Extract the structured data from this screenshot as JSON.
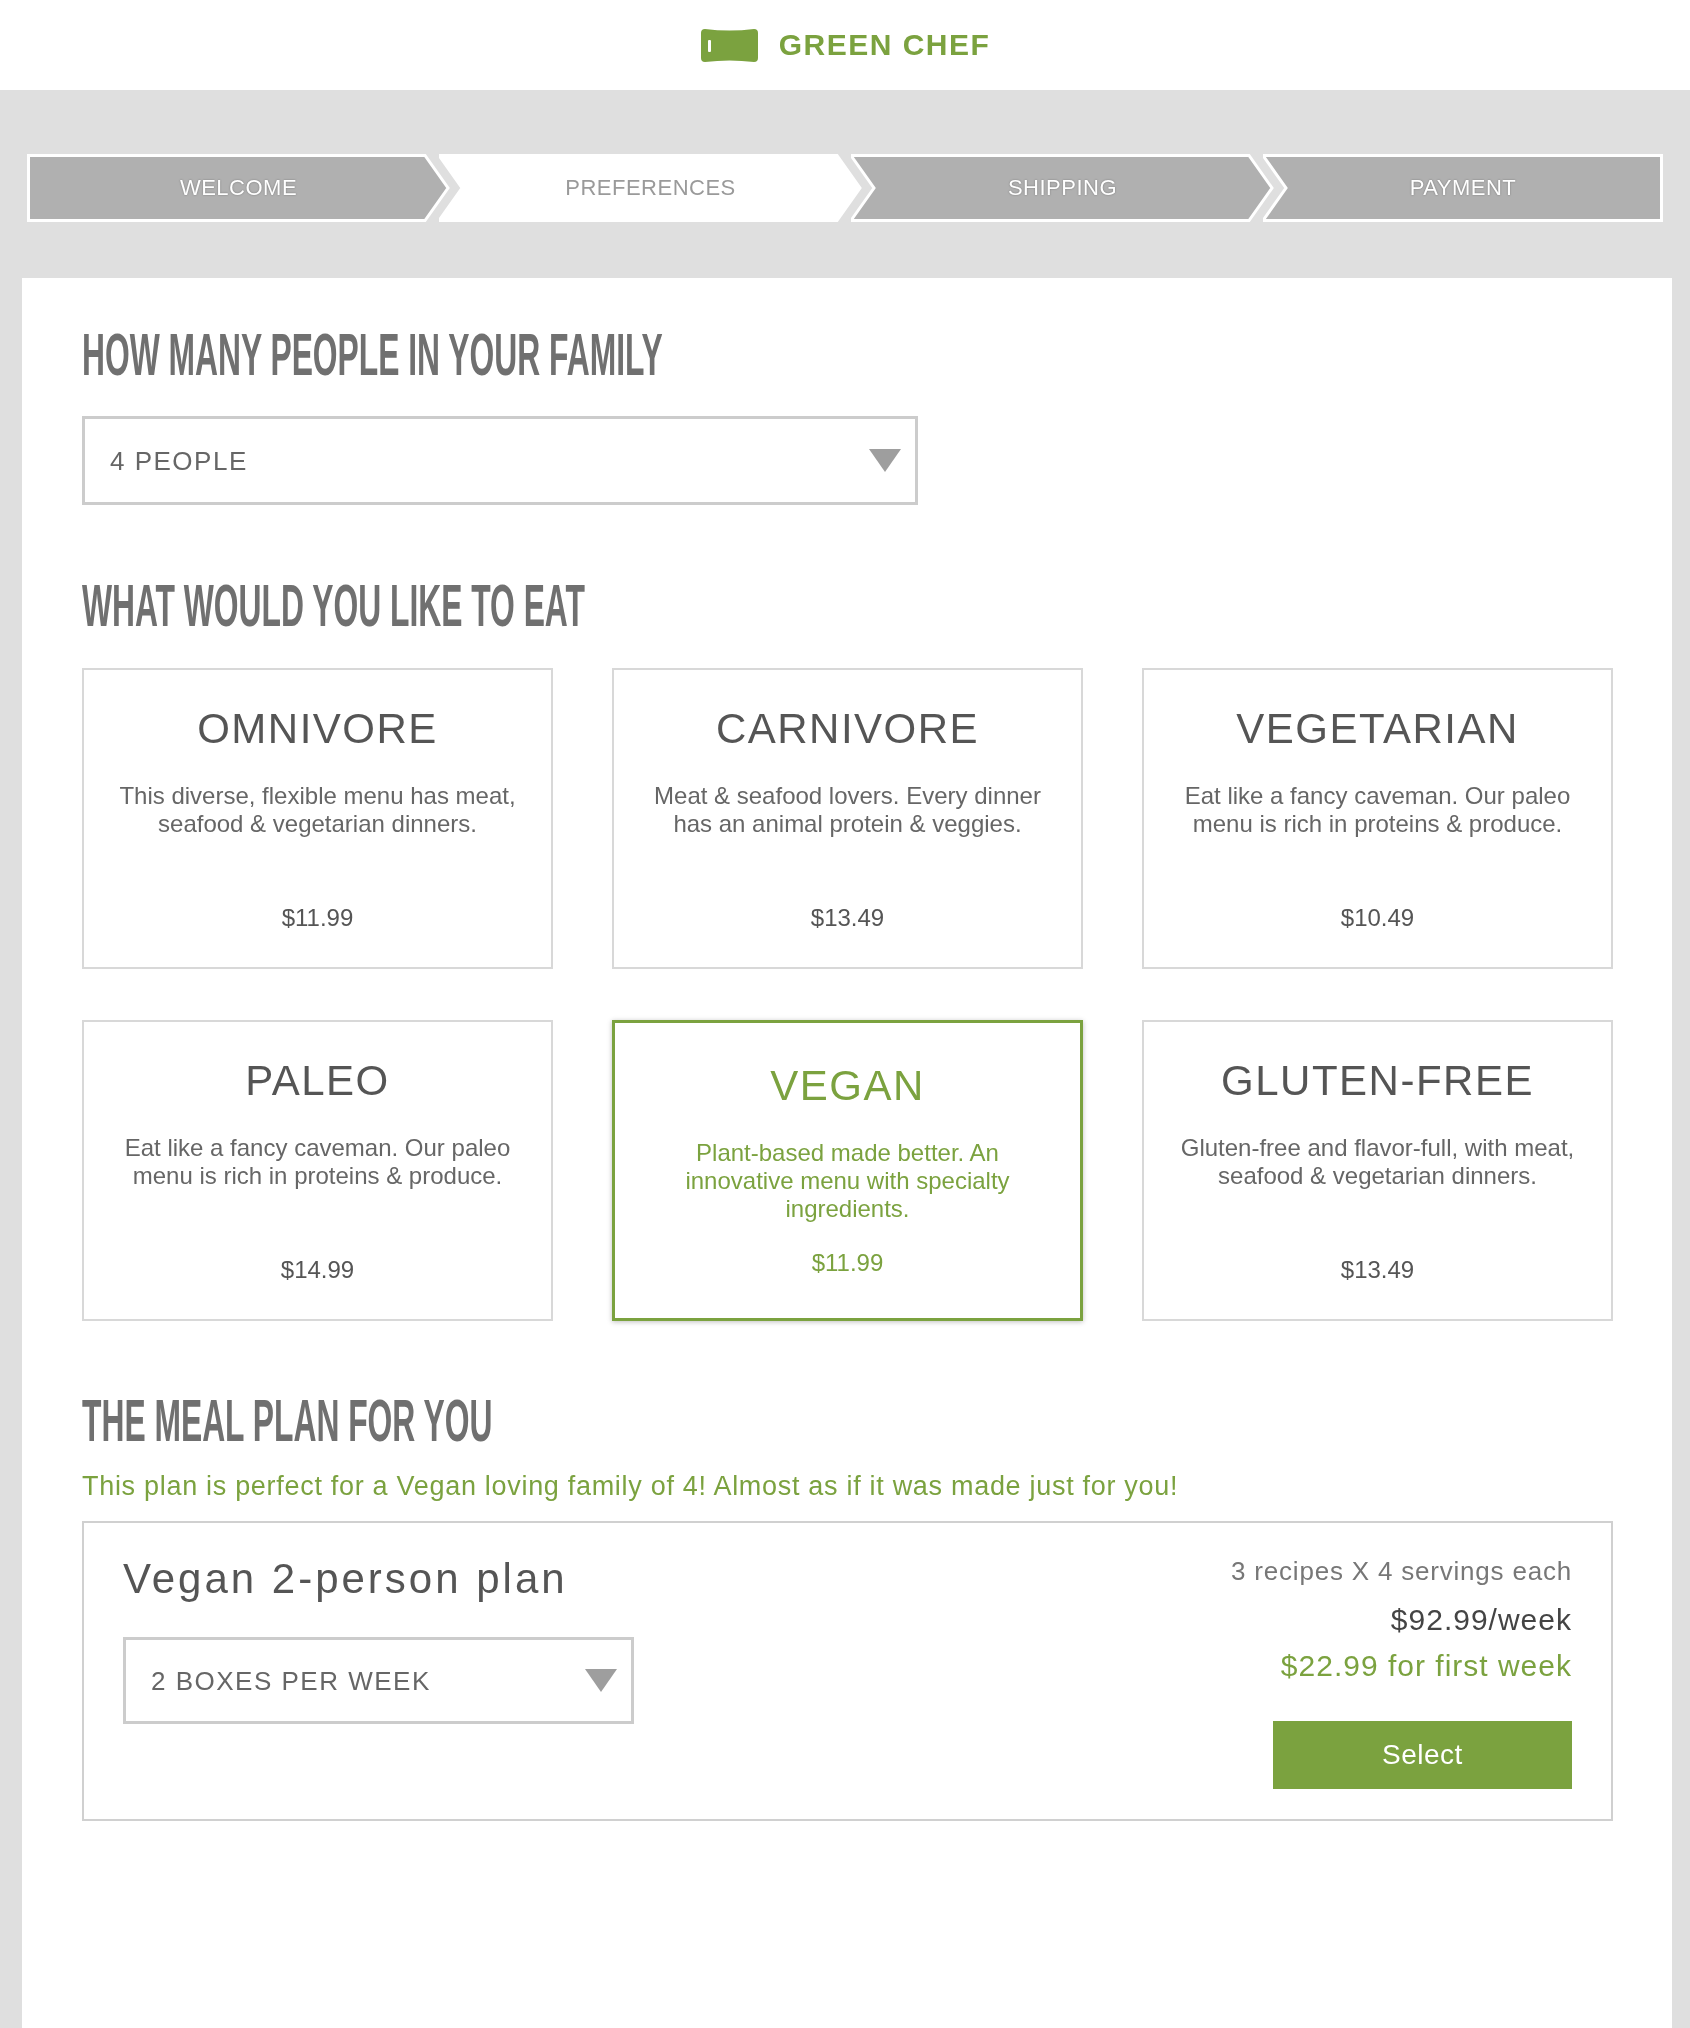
{
  "header": {
    "brand": "GREEN CHEF"
  },
  "steps": [
    {
      "label": "WELCOME",
      "selected": false
    },
    {
      "label": "PREFERENCES",
      "selected": true
    },
    {
      "label": "SHIPPING",
      "selected": false
    },
    {
      "label": "PAYMENT",
      "selected": false
    }
  ],
  "family": {
    "heading": "HOW MANY PEOPLE IN YOUR FAMILY",
    "value": "4 PEOPLE"
  },
  "menus": {
    "heading": "WHAT WOULD YOU LIKE TO EAT",
    "options": [
      {
        "name": "OMNIVORE",
        "description": "This diverse, flexible menu has meat, seafood & vegetarian dinners.",
        "price": "$11.99",
        "selected": false
      },
      {
        "name": "CARNIVORE",
        "description": "Meat & seafood lovers. Every dinner has an animal protein & veggies.",
        "price": "$13.49",
        "selected": false
      },
      {
        "name": "VEGETARIAN",
        "description": "Eat like a fancy caveman. Our paleo menu is rich in proteins & produce.",
        "price": "$10.49",
        "selected": false
      },
      {
        "name": "PALEO",
        "description": "Eat like a fancy caveman. Our paleo menu is rich in proteins & produce.",
        "price": "$14.99",
        "selected": false
      },
      {
        "name": "VEGAN",
        "description": "Plant-based made better. An innovative menu with specialty ingredients.",
        "price": "$11.99",
        "selected": true
      },
      {
        "name": "GLUTEN-FREE",
        "description": "Gluten-free and flavor-full, with meat, seafood & vegetarian dinners.",
        "price": "$13.49",
        "selected": false
      }
    ]
  },
  "meal_plan": {
    "heading": "THE MEAL PLAN FOR YOU",
    "message": "This plan is perfect for a Vegan loving family of 4! Almost as if it was made just for you!",
    "plan": {
      "title": "Vegan 2-person plan",
      "boxes": "2 BOXES PER WEEK",
      "servings": "3 recipes X 4 servings each",
      "weekly_price": "$92.99/week",
      "first_week_price": "$22.99 for first week",
      "button": "Select"
    }
  }
}
